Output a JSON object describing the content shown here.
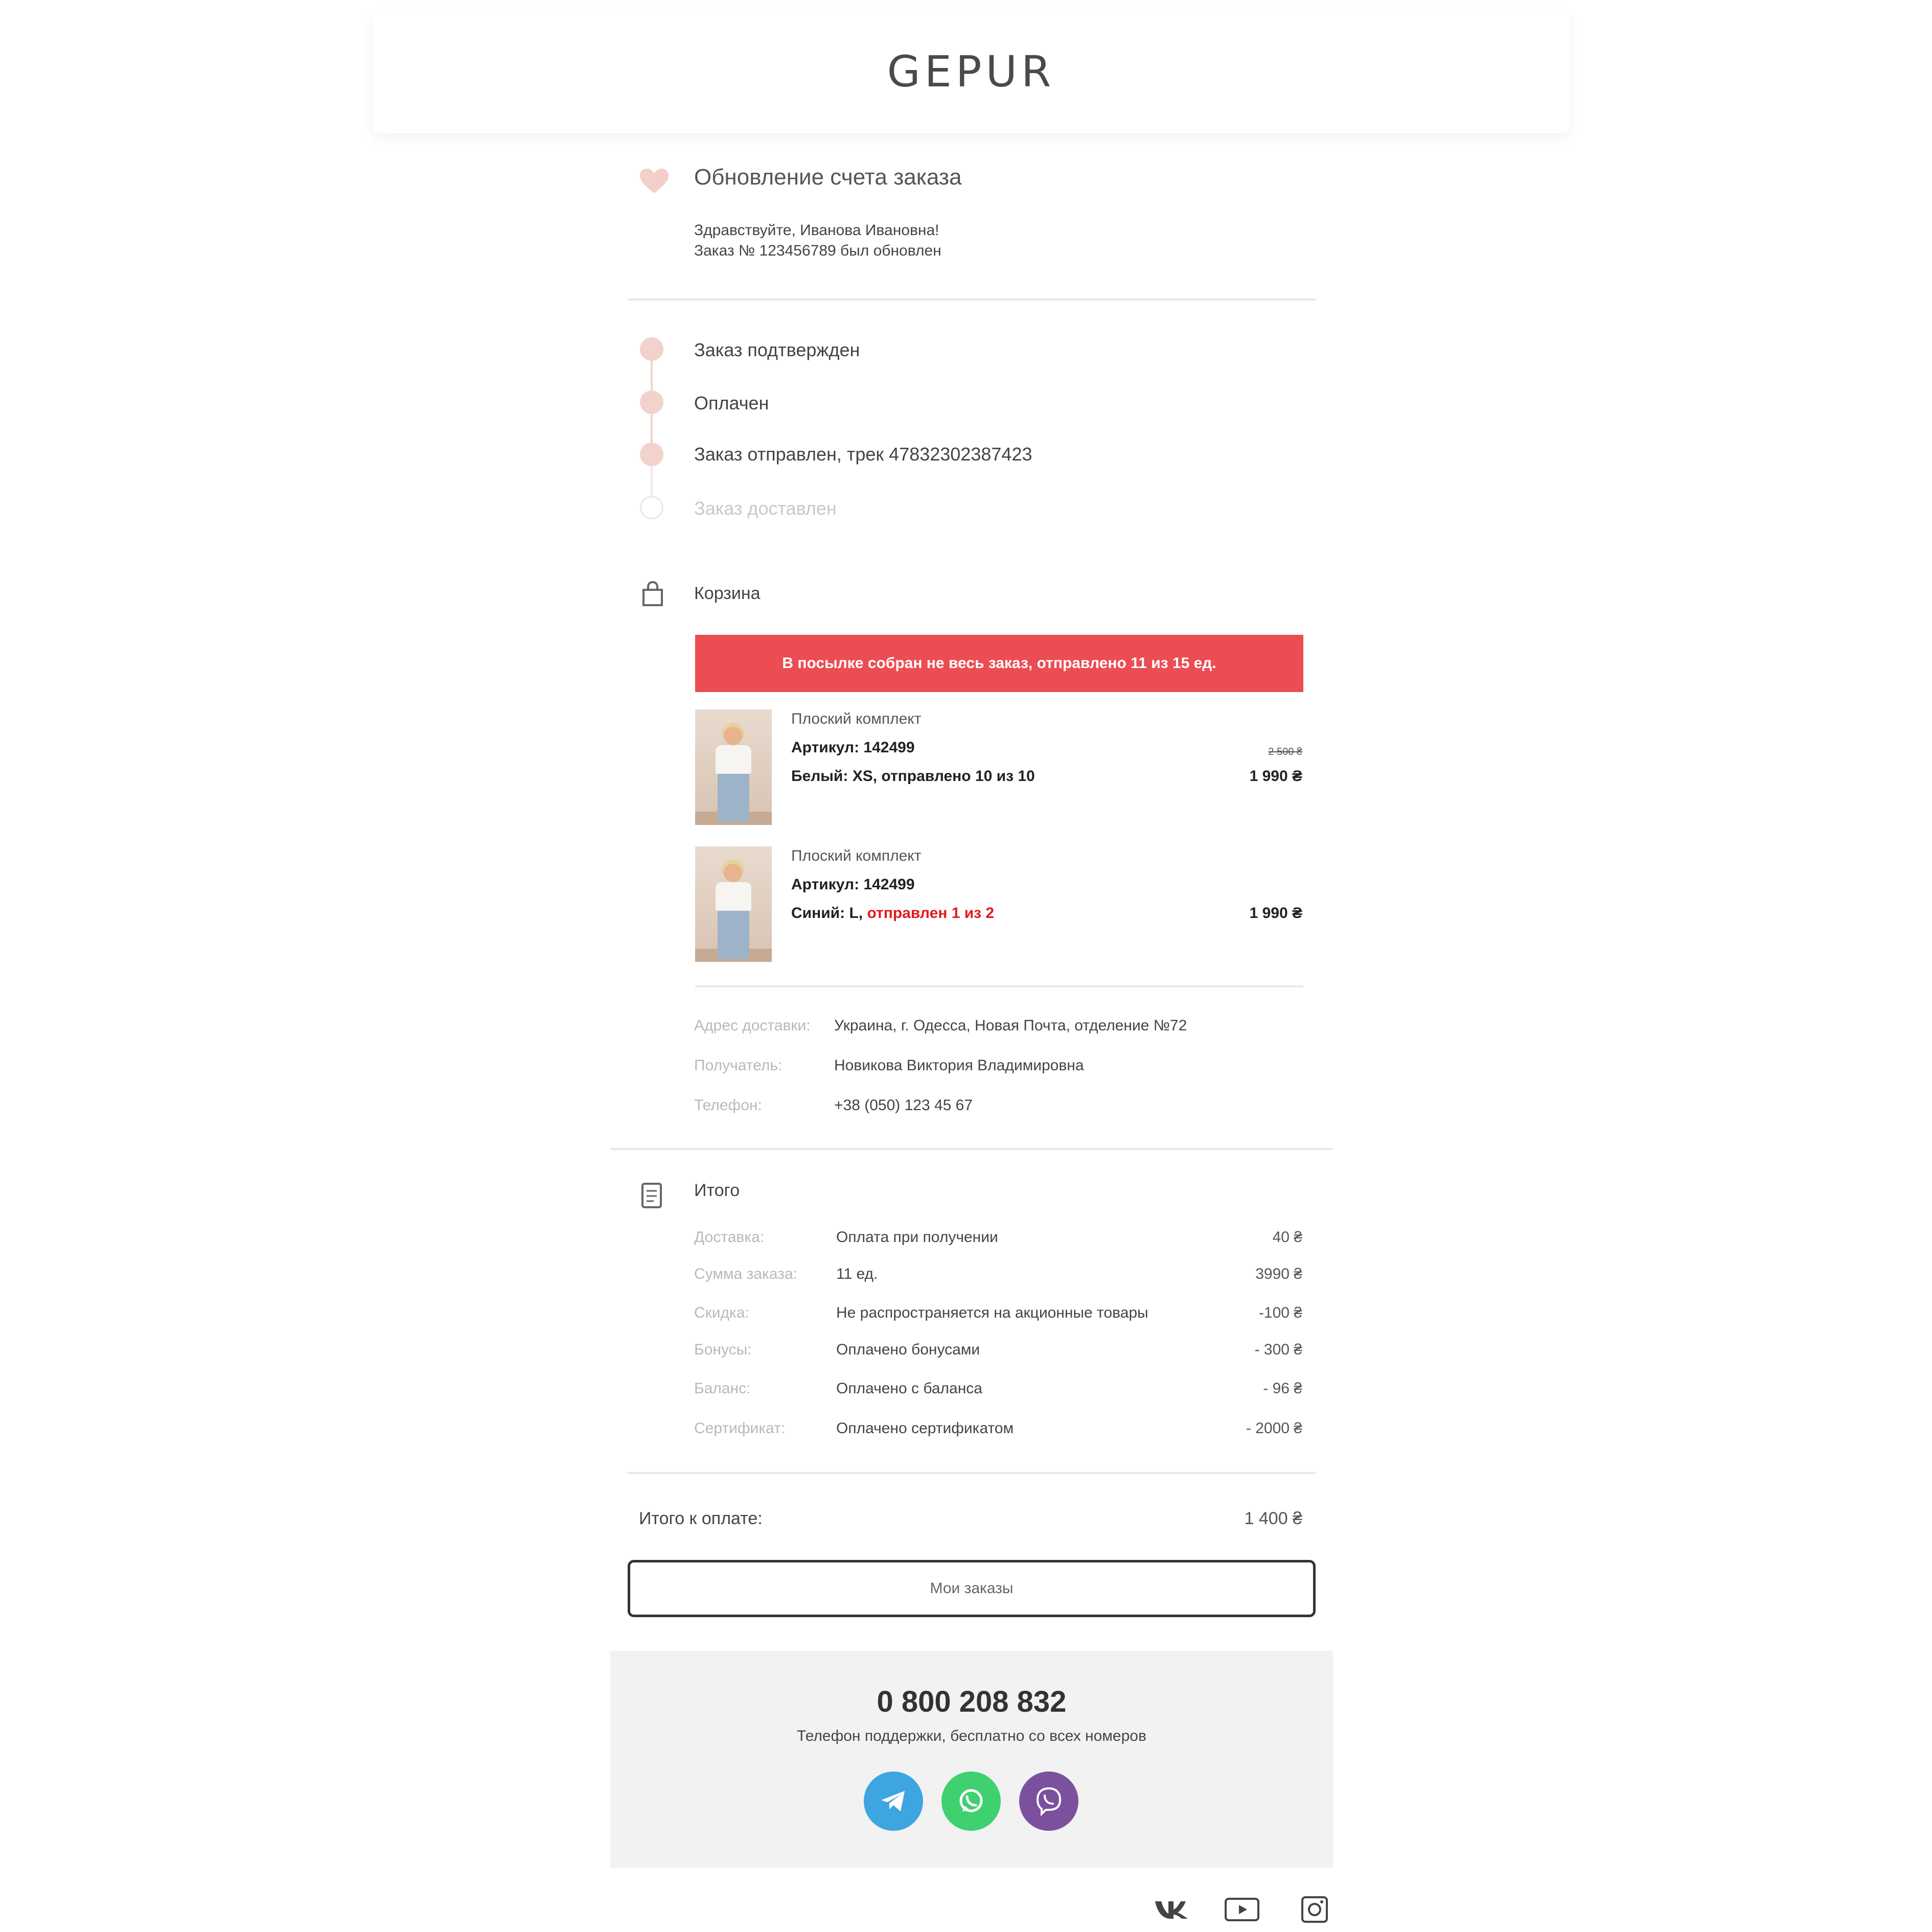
{
  "brand": {
    "logo": "GEPUR"
  },
  "colors": {
    "accent": "#eb4d53",
    "timeline": "#f3d2cc",
    "telegram": "#3da5df",
    "whatsapp": "#3fd070",
    "viber": "#7b519d"
  },
  "header_section": {
    "icon": "heart-icon",
    "title": "Обновление счета заказа",
    "greeting": "Здравствуйте, Иванова Ивановна!",
    "message": "Заказ № 123456789 был обновлен"
  },
  "timeline": {
    "steps": [
      {
        "label": "Заказ подтвержден",
        "done": true
      },
      {
        "label": "Оплачен",
        "done": true
      },
      {
        "label": "Заказ отправлен, трек 47832302387423",
        "done": true
      },
      {
        "label": "Заказ доставлен",
        "done": false
      }
    ]
  },
  "cart": {
    "icon": "shopping-bag-icon",
    "title": "Корзина",
    "banner": "В посылке собран не весь заказ, отправлено 11 из 15 ед.",
    "items": [
      {
        "name": "Плоский комплект",
        "article": "Артикул: 142499",
        "detail": "Белый: XS, отправлено 10 из 10",
        "detail_highlight": "",
        "old_price": "2 500 ₴",
        "price": "1 990 ₴"
      },
      {
        "name": "Плоский комплект",
        "article": "Артикул: 142499",
        "detail": "Синий: L,",
        "detail_highlight": "отправлен 1 из 2",
        "old_price": "",
        "price": "1 990 ₴"
      }
    ],
    "delivery": [
      {
        "label": "Адрес доставки:",
        "value": "Украина, г. Одесса, Новая Почта, отделение №72"
      },
      {
        "label": "Получатель:",
        "value": "Новикова Виктория Владимировна"
      },
      {
        "label": "Телефон:",
        "value": "+38 (050) 123 45 67"
      }
    ]
  },
  "summary": {
    "icon": "receipt-icon",
    "title": "Итого",
    "rows": [
      {
        "label": "Доставка:",
        "value": "Оплата при получении",
        "amount": "40 ₴"
      },
      {
        "label": "Сумма заказа:",
        "value": "11 ед.",
        "amount": "3990 ₴"
      },
      {
        "label": "Скидка:",
        "value": "Не распространяется на акционные товары",
        "amount": "-100 ₴"
      },
      {
        "label": "Бонусы:",
        "value": "Оплачено бонусами",
        "amount": "- 300 ₴"
      },
      {
        "label": "Баланс:",
        "value": "Оплачено с баланса",
        "amount": "- 96 ₴"
      },
      {
        "label": "Сертификат:",
        "value": "Оплачено сертификатом",
        "amount": "- 2000 ₴"
      }
    ],
    "total_label": "Итого к оплате:",
    "total_value": "1 400 ₴"
  },
  "orders_button": "Мои заказы",
  "support": {
    "phone": "0 800 208 832",
    "note": "Телефон поддержки, бесплатно со всех номеров",
    "messengers": [
      "telegram-icon",
      "whatsapp-icon",
      "viber-icon"
    ]
  },
  "social": [
    "vk-icon",
    "youtube-icon",
    "instagram-icon"
  ]
}
